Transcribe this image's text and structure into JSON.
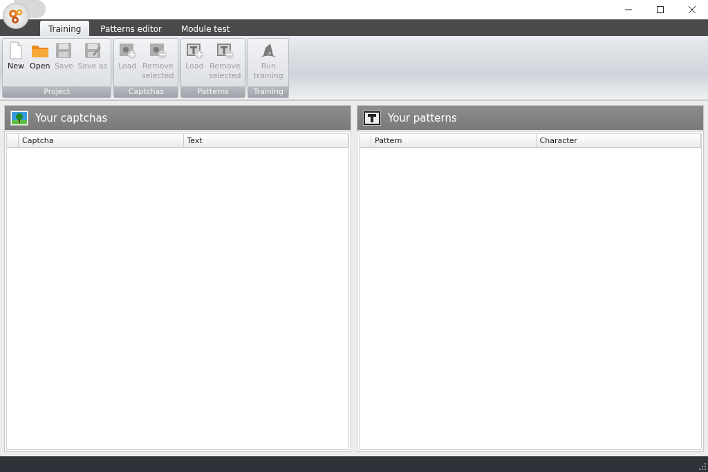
{
  "tabs": [
    {
      "label": "Training",
      "selected": true
    },
    {
      "label": "Patterns editor",
      "selected": false
    },
    {
      "label": "Module test",
      "selected": false
    }
  ],
  "ribbon_groups": [
    {
      "title": "Project",
      "buttons": [
        {
          "label": "New",
          "kind": "new",
          "disabled": false
        },
        {
          "label": "Open",
          "kind": "open",
          "disabled": false
        },
        {
          "label": "Save",
          "kind": "save",
          "disabled": true
        },
        {
          "label": "Save as",
          "kind": "save-as",
          "disabled": true
        }
      ]
    },
    {
      "title": "Captchas",
      "buttons": [
        {
          "label": "Load",
          "kind": "image-add",
          "disabled": true
        },
        {
          "label": "Remove selected",
          "kind": "image-remove",
          "disabled": true
        }
      ]
    },
    {
      "title": "Patterns",
      "buttons": [
        {
          "label": "Load",
          "kind": "text-add",
          "disabled": true
        },
        {
          "label": "Remove selected",
          "kind": "text-remove",
          "disabled": true
        }
      ]
    },
    {
      "title": "Training",
      "buttons": [
        {
          "label": "Run training",
          "kind": "wizard",
          "disabled": true
        }
      ]
    }
  ],
  "panels": [
    {
      "title": "Your captchas",
      "kind": "image",
      "columns": [
        "Captcha",
        "Text"
      ]
    },
    {
      "title": "Your patterns",
      "kind": "text",
      "columns": [
        "Pattern",
        "Character"
      ]
    }
  ]
}
